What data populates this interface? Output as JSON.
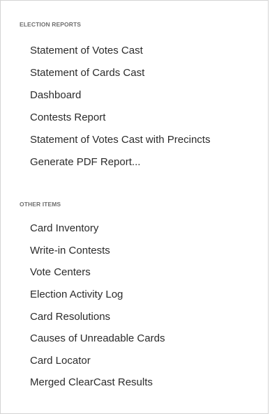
{
  "sections": [
    {
      "header": "ELECTION REPORTS",
      "items": [
        "Statement of Votes Cast",
        "Statement of Cards Cast",
        "Dashboard",
        "Contests Report",
        "Statement of Votes Cast with Precincts",
        "Generate PDF Report..."
      ]
    },
    {
      "header": "OTHER ITEMS",
      "items": [
        "Card Inventory",
        "Write-in Contests",
        "Vote Centers",
        "Election Activity Log",
        "Card Resolutions",
        "Causes of Unreadable Cards",
        "Card Locator",
        "Merged ClearCast Results"
      ]
    }
  ]
}
